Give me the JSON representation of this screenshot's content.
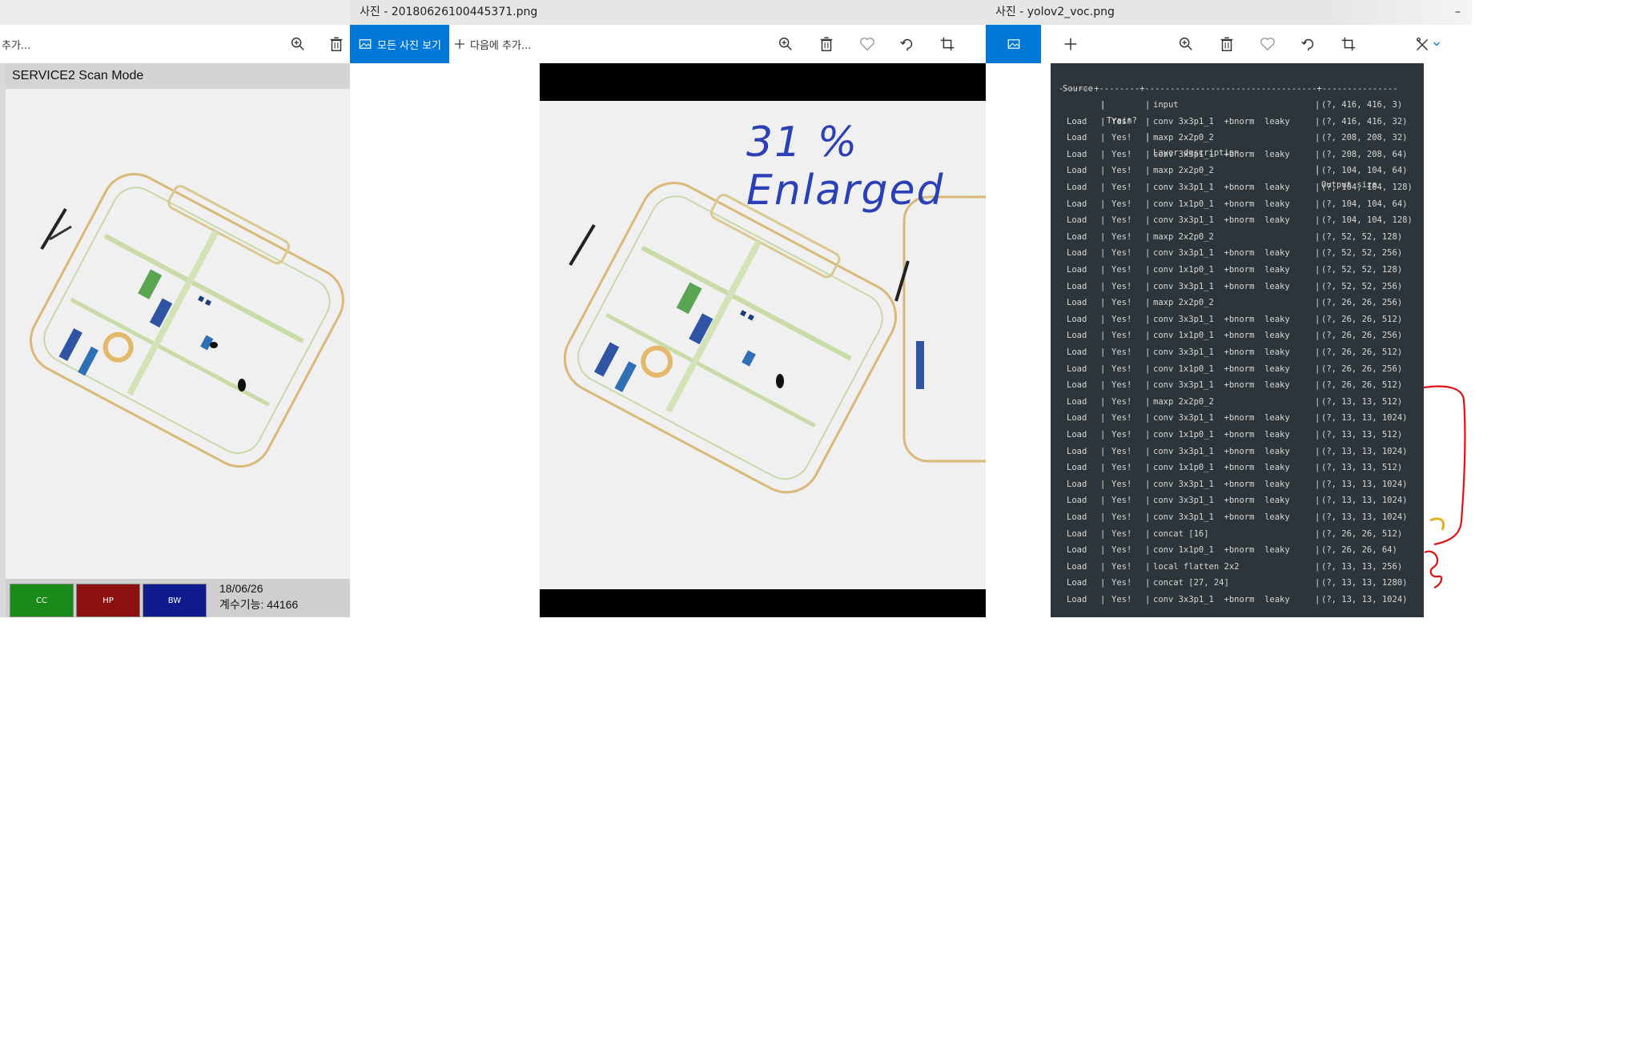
{
  "window1": {
    "toolbar_text": "추가...",
    "scan": {
      "header": "SERVICE2 Scan Mode",
      "buttons": [
        {
          "label": "CC",
          "color": "#1a8a1a"
        },
        {
          "label": "HP",
          "color": "#8b1010"
        },
        {
          "label": "BW",
          "color": "#0f1a8c"
        }
      ],
      "date": "18/06/26",
      "count_text": "계수기능: 44166"
    }
  },
  "window2": {
    "title": "사진 - 20180626100445371.png",
    "view_all_label": "모든 사진 보기",
    "add_to_label": "다음에 추가...",
    "annotation": "31 % Enlarged"
  },
  "window3": {
    "title": "사진 - yolov2_voc.png",
    "minimize_label": "–",
    "table": {
      "header": [
        "Source",
        "Train?",
        "Layer description",
        "Output size"
      ],
      "separator": "-------+--------+----------------------------------+---------------",
      "rows": [
        [
          "",
          "",
          "input",
          "(?, 416, 416, 3)"
        ],
        [
          "Load",
          "Yes!",
          "conv 3x3p1_1  +bnorm  leaky",
          "(?, 416, 416, 32)"
        ],
        [
          "Load",
          "Yes!",
          "maxp 2x2p0_2",
          "(?, 208, 208, 32)"
        ],
        [
          "Load",
          "Yes!",
          "conv 3x3p1_1  +bnorm  leaky",
          "(?, 208, 208, 64)"
        ],
        [
          "Load",
          "Yes!",
          "maxp 2x2p0_2",
          "(?, 104, 104, 64)"
        ],
        [
          "Load",
          "Yes!",
          "conv 3x3p1_1  +bnorm  leaky",
          "(?, 104, 104, 128)"
        ],
        [
          "Load",
          "Yes!",
          "conv 1x1p0_1  +bnorm  leaky",
          "(?, 104, 104, 64)"
        ],
        [
          "Load",
          "Yes!",
          "conv 3x3p1_1  +bnorm  leaky",
          "(?, 104, 104, 128)"
        ],
        [
          "Load",
          "Yes!",
          "maxp 2x2p0_2",
          "(?, 52, 52, 128)"
        ],
        [
          "Load",
          "Yes!",
          "conv 3x3p1_1  +bnorm  leaky",
          "(?, 52, 52, 256)"
        ],
        [
          "Load",
          "Yes!",
          "conv 1x1p0_1  +bnorm  leaky",
          "(?, 52, 52, 128)"
        ],
        [
          "Load",
          "Yes!",
          "conv 3x3p1_1  +bnorm  leaky",
          "(?, 52, 52, 256)"
        ],
        [
          "Load",
          "Yes!",
          "maxp 2x2p0_2",
          "(?, 26, 26, 256)"
        ],
        [
          "Load",
          "Yes!",
          "conv 3x3p1_1  +bnorm  leaky",
          "(?, 26, 26, 512)"
        ],
        [
          "Load",
          "Yes!",
          "conv 1x1p0_1  +bnorm  leaky",
          "(?, 26, 26, 256)"
        ],
        [
          "Load",
          "Yes!",
          "conv 3x3p1_1  +bnorm  leaky",
          "(?, 26, 26, 512)"
        ],
        [
          "Load",
          "Yes!",
          "conv 1x1p0_1  +bnorm  leaky",
          "(?, 26, 26, 256)"
        ],
        [
          "Load",
          "Yes!",
          "conv 3x3p1_1  +bnorm  leaky",
          "(?, 26, 26, 512)"
        ],
        [
          "Load",
          "Yes!",
          "maxp 2x2p0_2",
          "(?, 13, 13, 512)"
        ],
        [
          "Load",
          "Yes!",
          "conv 3x3p1_1  +bnorm  leaky",
          "(?, 13, 13, 1024)"
        ],
        [
          "Load",
          "Yes!",
          "conv 1x1p0_1  +bnorm  leaky",
          "(?, 13, 13, 512)"
        ],
        [
          "Load",
          "Yes!",
          "conv 3x3p1_1  +bnorm  leaky",
          "(?, 13, 13, 1024)"
        ],
        [
          "Load",
          "Yes!",
          "conv 1x1p0_1  +bnorm  leaky",
          "(?, 13, 13, 512)"
        ],
        [
          "Load",
          "Yes!",
          "conv 3x3p1_1  +bnorm  leaky",
          "(?, 13, 13, 1024)"
        ],
        [
          "Load",
          "Yes!",
          "conv 3x3p1_1  +bnorm  leaky",
          "(?, 13, 13, 1024)"
        ],
        [
          "Load",
          "Yes!",
          "conv 3x3p1_1  +bnorm  leaky",
          "(?, 13, 13, 1024)"
        ],
        [
          "Load",
          "Yes!",
          "concat [16]",
          "(?, 26, 26, 512)"
        ],
        [
          "Load",
          "Yes!",
          "conv 1x1p0_1  +bnorm  leaky",
          "(?, 26, 26, 64)"
        ],
        [
          "Load",
          "Yes!",
          "local flatten 2x2",
          "(?, 13, 13, 256)"
        ],
        [
          "Load",
          "Yes!",
          "concat [27, 24]",
          "(?, 13, 13, 1280)"
        ],
        [
          "Load",
          "Yes!",
          "conv 3x3p1_1  +bnorm  leaky",
          "(?, 13, 13, 1024)"
        ]
      ]
    }
  },
  "colors": {
    "accent": "#0078d7",
    "terminal_bg": "#2d353b",
    "annotation_blue": "#2b3fb7",
    "annotation_red": "#e01010"
  }
}
